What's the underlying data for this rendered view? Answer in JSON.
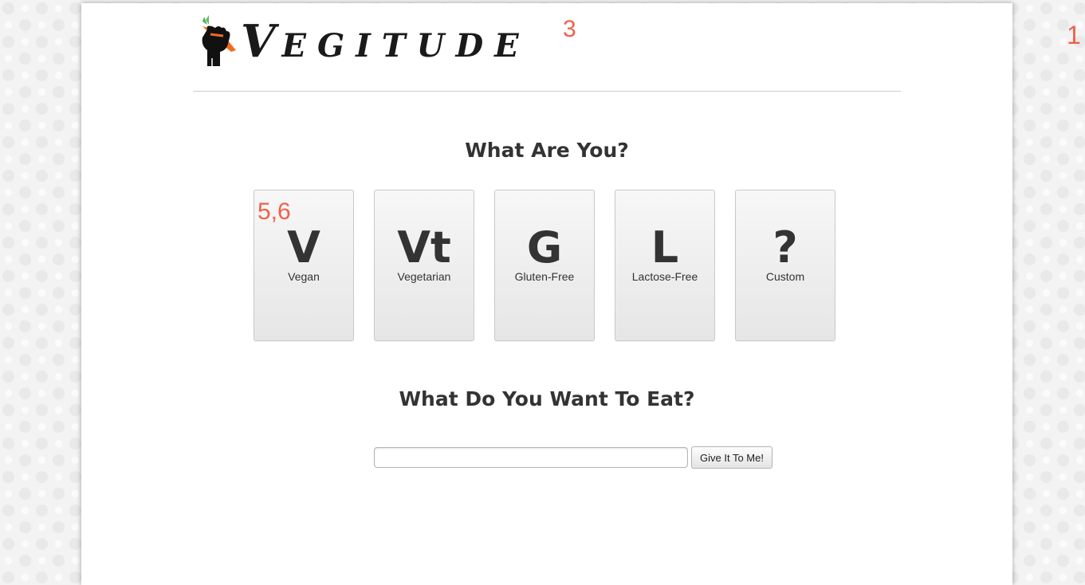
{
  "header": {
    "logo_text_first": "V",
    "logo_text_rest": "egitude",
    "logo_icon": "fist-carrot-icon",
    "annotation_superscript": "3",
    "annotation_right": "1"
  },
  "diet_section": {
    "title": "What Are You?",
    "annotation": "5,6",
    "cards": [
      {
        "symbol": "V",
        "label": "Vegan"
      },
      {
        "symbol": "Vt",
        "label": "Vegetarian"
      },
      {
        "symbol": "G",
        "label": "Gluten-Free"
      },
      {
        "symbol": "L",
        "label": "Lactose-Free"
      },
      {
        "symbol": "?",
        "label": "Custom"
      }
    ]
  },
  "search_section": {
    "title": "What Do You Want To Eat?",
    "input_value": "",
    "input_placeholder": "",
    "button_label": "Give It To Me!"
  },
  "colors": {
    "annotation": "#f0604a",
    "carrot": "#f26b21",
    "text": "#333333"
  }
}
